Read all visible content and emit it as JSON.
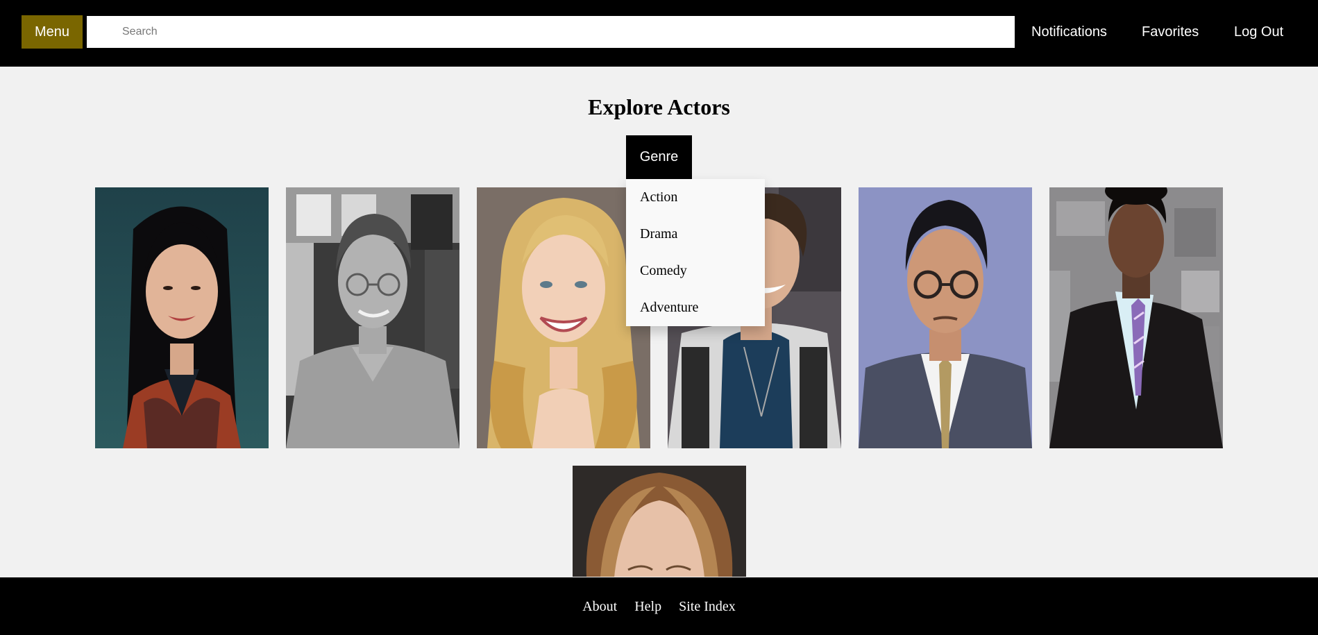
{
  "header": {
    "menu_label": "Menu",
    "search_placeholder": "Search",
    "search_value": "",
    "nav_links": [
      "Notifications",
      "Favorites",
      "Log Out"
    ]
  },
  "main": {
    "title": "Explore Actors",
    "genre_button": "Genre",
    "genre_options": [
      "Action",
      "Drama",
      "Comedy",
      "Adventure"
    ]
  },
  "footer": {
    "links": [
      "About",
      "Help",
      "Site Index"
    ]
  },
  "colors": {
    "header_bg": "#000000",
    "menu_button_bg": "#7a6600",
    "page_bg": "#f1f1f1",
    "dropdown_bg": "#f9f9f9",
    "footer_bg": "#000000"
  }
}
